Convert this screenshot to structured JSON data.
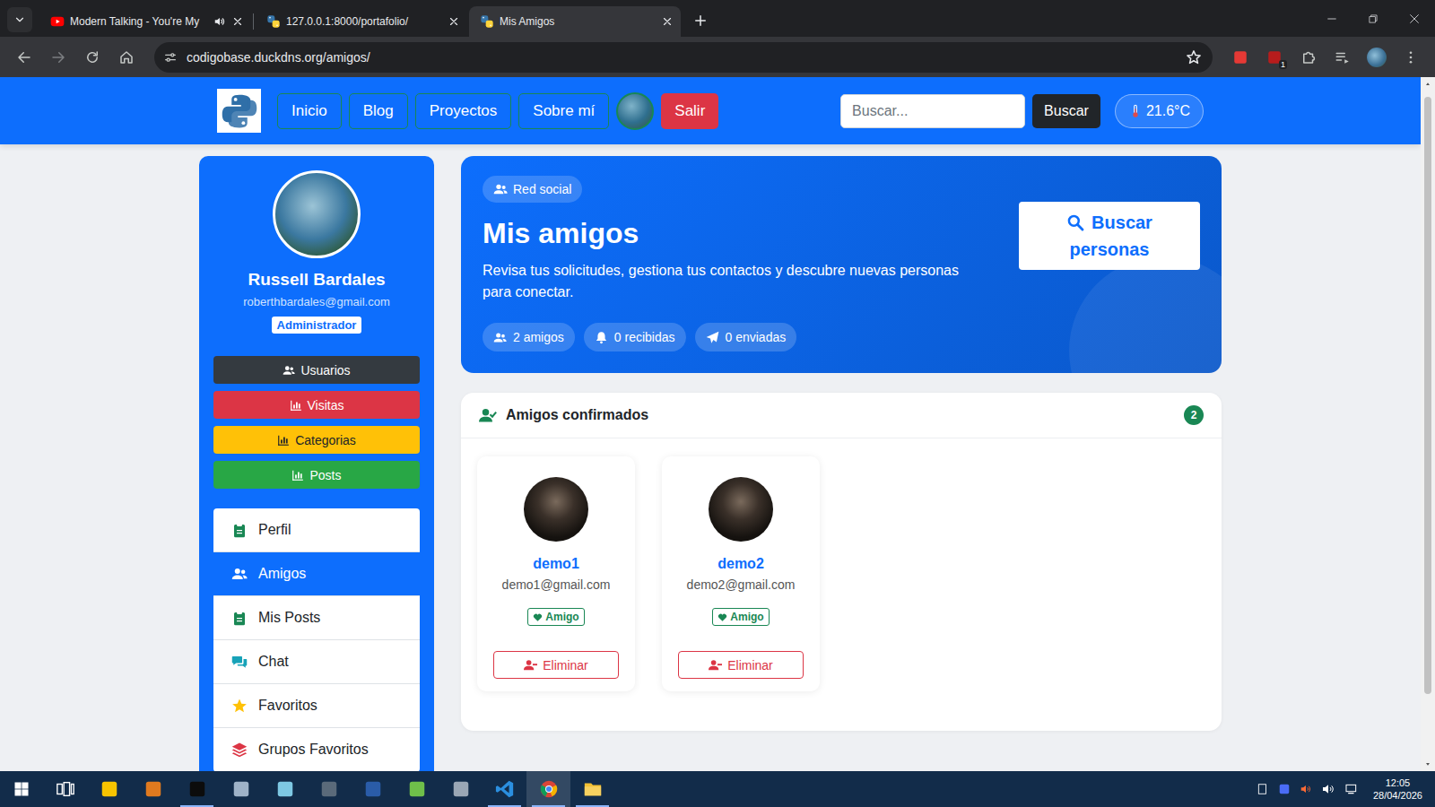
{
  "browser": {
    "tabs": [
      {
        "label": "Modern Talking - You're My",
        "selected": false,
        "playing": true
      },
      {
        "label": "127.0.0.1:8000/portafolio/",
        "selected": false,
        "playing": false
      },
      {
        "label": "Mis Amigos",
        "selected": true,
        "playing": false
      }
    ],
    "url": "codigobase.duckdns.org/amigos/",
    "extension_badge": "1"
  },
  "navbar": {
    "links": [
      "Inicio",
      "Blog",
      "Proyectos",
      "Sobre mí"
    ],
    "logout": "Salir",
    "search": {
      "placeholder": "Buscar..."
    },
    "search_button": "Buscar",
    "temperature": "21.6°C"
  },
  "sidebar": {
    "name": "Russell Bardales",
    "email": "roberthbardales@gmail.com",
    "role": "Administrador",
    "admin_buttons": [
      {
        "label": "Usuarios",
        "color": "#343a40"
      },
      {
        "label": "Visitas",
        "color": "#dc3545"
      },
      {
        "label": "Categorias",
        "color": "#ffc107"
      },
      {
        "label": "Posts",
        "color": "#28a745"
      }
    ],
    "menu": [
      {
        "label": "Perfil",
        "selected": false
      },
      {
        "label": "Amigos",
        "selected": true
      },
      {
        "label": "Mis Posts",
        "selected": false
      },
      {
        "label": "Chat",
        "selected": false
      },
      {
        "label": "Favoritos",
        "selected": false
      },
      {
        "label": "Grupos Favoritos",
        "selected": false
      }
    ]
  },
  "hero": {
    "badge": "Red social",
    "title": "Mis amigos",
    "description": "Revisa tus solicitudes, gestiona tus contactos y descubre nuevas personas para conectar.",
    "stats": [
      "2 amigos",
      "0 recibidas",
      "0 enviadas"
    ],
    "action": "Buscar personas"
  },
  "friends": {
    "title": "Amigos confirmados",
    "count": "2",
    "items": [
      {
        "name": "demo1",
        "email": "demo1@gmail.com",
        "status": "Amigo",
        "action": "Eliminar"
      },
      {
        "name": "demo2",
        "email": "demo2@gmail.com",
        "status": "Amigo",
        "action": "Eliminar"
      }
    ]
  },
  "taskbar": {
    "apps": [
      {
        "open": false,
        "selected": false
      },
      {
        "open": false,
        "selected": false
      },
      {
        "open": false,
        "selected": false
      },
      {
        "open": true,
        "selected": false
      },
      {
        "open": false,
        "selected": false
      },
      {
        "open": false,
        "selected": false
      },
      {
        "open": false,
        "selected": false
      },
      {
        "open": false,
        "selected": false
      },
      {
        "open": false,
        "selected": false
      },
      {
        "open": false,
        "selected": false
      },
      {
        "open": true,
        "selected": false
      },
      {
        "open": true,
        "selected": true
      },
      {
        "open": true,
        "selected": false
      }
    ],
    "time": "12:05",
    "date": "28/04/2026"
  }
}
